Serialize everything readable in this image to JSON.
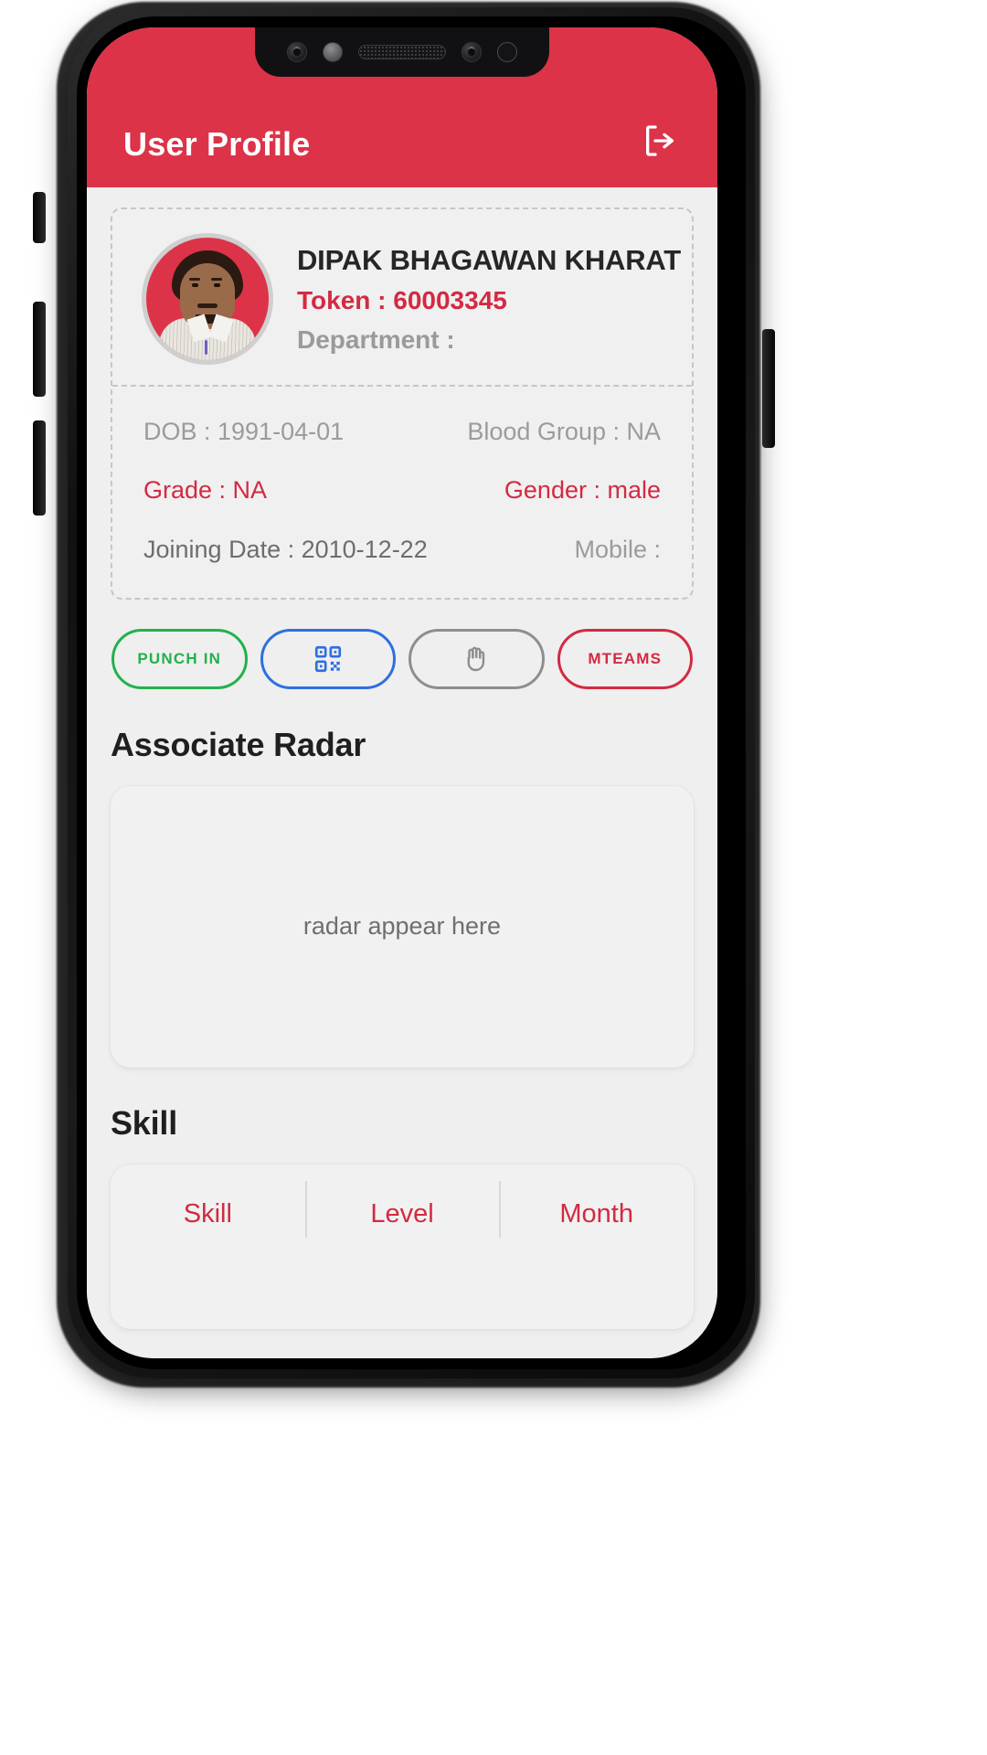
{
  "header": {
    "title": "User Profile",
    "logout_icon": "logout-icon",
    "background_color": "#dc3349",
    "title_color": "#ffffff"
  },
  "profile": {
    "avatar_alt": "user-avatar-photo",
    "name": "DIPAK BHAGAWAN KHARAT",
    "token_label": "Token : 60003345",
    "department_label": "Department :",
    "details": [
      {
        "left": "DOB : 1991-04-01",
        "left_color": "gray",
        "right": "Blood Group : NA",
        "right_color": "gray"
      },
      {
        "left": "Grade : NA",
        "left_color": "red",
        "right": "Gender : male",
        "right_color": "red"
      },
      {
        "left": "Joining Date : 2010-12-22",
        "left_color": "dark",
        "right": "Mobile :",
        "right_color": "gray"
      }
    ]
  },
  "actions": [
    {
      "label": "PUNCH IN",
      "icon": "",
      "name": "punch-in-button",
      "color": "#22b14c"
    },
    {
      "label": "",
      "icon": "qr-code-icon",
      "name": "qr-scan-button",
      "color": "#2f6fe0"
    },
    {
      "label": "",
      "icon": "hand-icon",
      "name": "hand-button",
      "color": "#8e8e8e"
    },
    {
      "label": "MTEAMS",
      "icon": "",
      "name": "mteams-button",
      "color": "#d32a42"
    }
  ],
  "radar_section": {
    "title": "Associate Radar",
    "placeholder": "radar appear here"
  },
  "skill_section": {
    "title": "Skill",
    "columns": [
      "Skill",
      "Level",
      "Month"
    ],
    "rows": [
      [
        "",
        "",
        ""
      ]
    ]
  }
}
